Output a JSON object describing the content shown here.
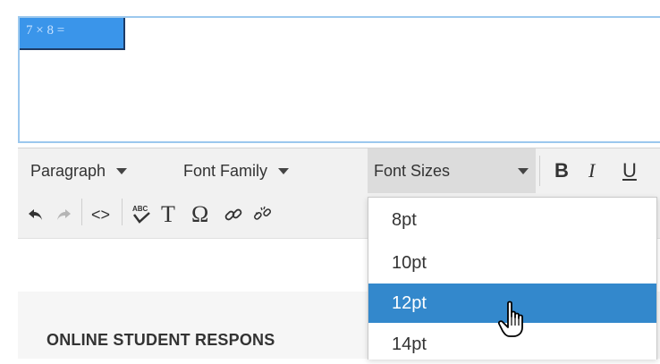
{
  "editor": {
    "content_expression": "7 × 8 ="
  },
  "toolbar": {
    "paragraph_label": "Paragraph",
    "font_family_label": "Font Family",
    "font_sizes_label": "Font Sizes",
    "bold_label": "B",
    "italic_label": "I",
    "underline_label": "U",
    "text_icon_glyph": "T",
    "omega_icon_glyph": "Ω",
    "source_icon_glyph": "<>"
  },
  "font_size_dropdown": {
    "items": [
      "8pt",
      "10pt",
      "12pt",
      "14pt"
    ],
    "selected": "12pt"
  },
  "section": {
    "title": "ONLINE STUDENT RESPONS"
  },
  "colors": {
    "selection_blue": "#3388cc",
    "math_highlight": "#3a95ea",
    "editor_border": "#9cc8ee"
  }
}
